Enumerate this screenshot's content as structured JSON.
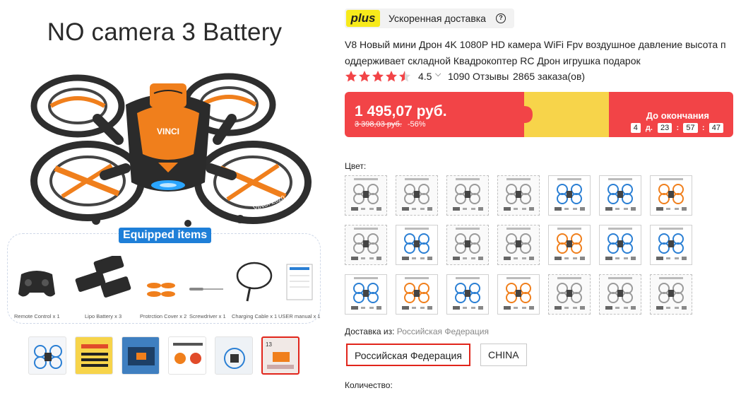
{
  "gallery": {
    "main_image_title": "NO camera 3 Battery",
    "drone_brand": "VINCI",
    "equipped_label": "Equipped items",
    "equipped_items": [
      {
        "label": "Remote Control x 1"
      },
      {
        "label": "Lipo Battery x 3"
      },
      {
        "label": "Protrction Cover x 2"
      },
      {
        "label": "Screwdriver x 1"
      },
      {
        "label": "Charging Cable x 1"
      },
      {
        "label": "USER manual x 1"
      }
    ],
    "thumbnails": [
      {
        "name": "thumb-1",
        "active": false
      },
      {
        "name": "thumb-2",
        "active": false
      },
      {
        "name": "thumb-3",
        "active": false
      },
      {
        "name": "thumb-4",
        "active": false
      },
      {
        "name": "thumb-5",
        "active": false
      },
      {
        "name": "thumb-6",
        "active": true
      }
    ]
  },
  "plus": {
    "badge": "plus",
    "text": "Ускоренная доставка",
    "help_icon": "question-circle-icon"
  },
  "product": {
    "title": "V8 Новый мини Дрон 4K 1080P HD камера WiFi Fpv воздушное давление высота п оддерживает складной Квадрокоптер RC Дрон игрушка подарок",
    "rating": "4.5",
    "rating_stars": 4.5,
    "reviews": "1090 Отзывы",
    "orders": "2865 заказа(ов)"
  },
  "price": {
    "current": "1 495,07 руб.",
    "old": "3 398,03 руб.",
    "discount": "-56%",
    "countdown_label": "До окончания",
    "days": "4",
    "days_unit": "д.",
    "hours": "23",
    "minutes": "57",
    "seconds": "47",
    "banner_color": "#f24447",
    "puzzle_color": "#f7d44a"
  },
  "options": {
    "color_label": "Цвет:",
    "swatch_count": 21
  },
  "shipping": {
    "label": "Доставка из:",
    "value": "Российская Федерация",
    "buttons": [
      {
        "label": "Российская Федерация",
        "selected": true
      },
      {
        "label": "CHINA",
        "selected": false
      }
    ]
  },
  "quantity": {
    "label": "Количество:"
  },
  "colors": {
    "accent_red": "#e1251b",
    "plus_yellow": "#f7ea1b",
    "star_color": "#f24447",
    "drone_orange": "#f07f1c"
  }
}
